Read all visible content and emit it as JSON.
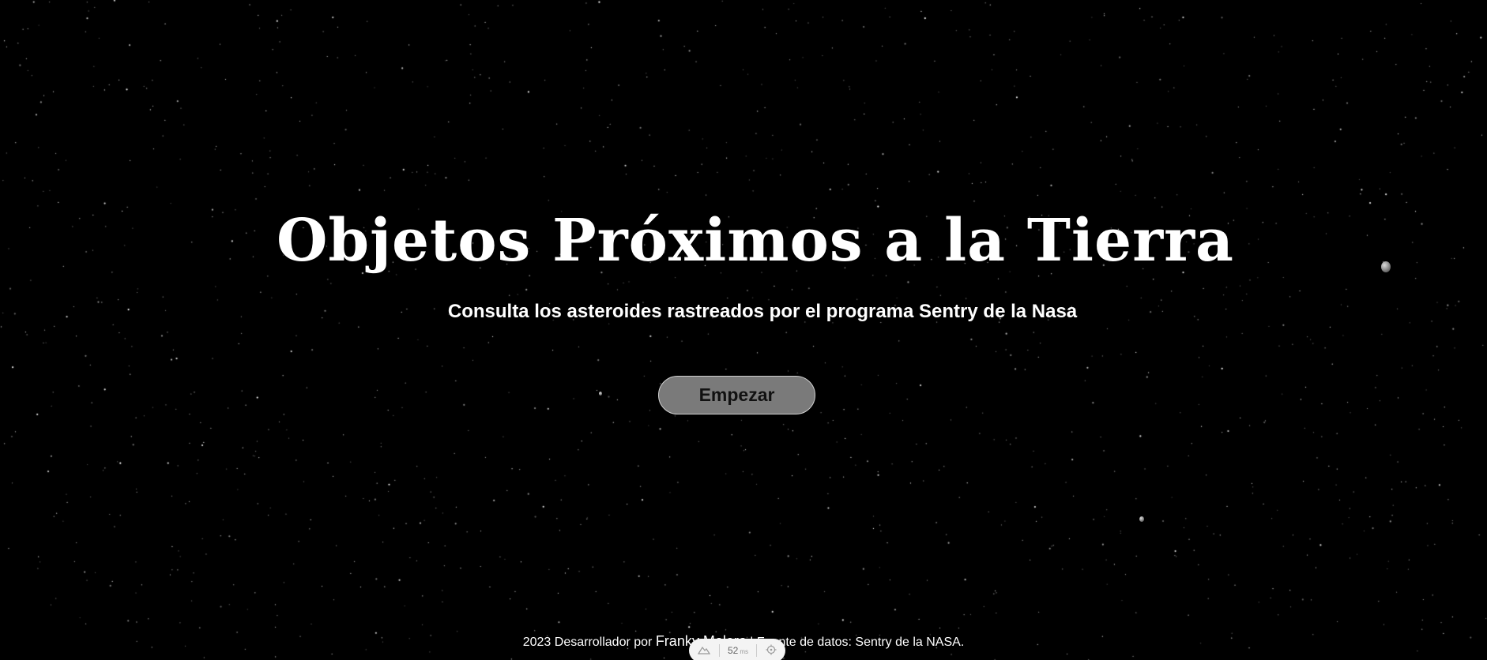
{
  "hero": {
    "title": "Objetos Próximos a la Tierra",
    "subtitle": "Consulta los asteroides rastreados por el programa Sentry de la Nasa",
    "start_label": "Empezar"
  },
  "footer": {
    "prefix": "2023 Desarrollador por ",
    "author": "Franky Molero",
    "separator": " | ",
    "source": "Fuente de datos: Sentry de la NASA."
  },
  "perf_widget": {
    "left_icon": "mountain-icon",
    "value": "52",
    "unit": "ms",
    "right_icon": "target-icon"
  },
  "colors": {
    "background": "#000000",
    "text": "#ffffff",
    "button_bg": "#7a7a7a",
    "button_border": "#d0d0d0"
  }
}
